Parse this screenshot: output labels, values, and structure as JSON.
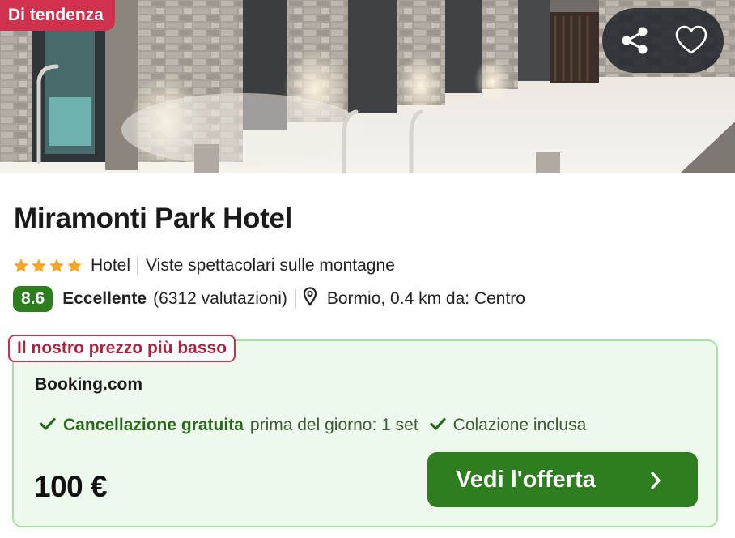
{
  "hero": {
    "image_description": "",
    "badge": "Di tendenza"
  },
  "actions": {
    "share_icon": "share-icon",
    "favorite_icon": "heart-outline-icon"
  },
  "hotel": {
    "name": "Miramonti Park Hotel",
    "stars": 4,
    "type": "Hotel",
    "tagline": "Viste spettacolari sulle montagne",
    "score": "8.6",
    "score_label": "Eccellente",
    "reviews": "(6312 valutazioni)",
    "location": "Bormio, 0.4 km da: Centro"
  },
  "offer": {
    "badge": "Il nostro prezzo più basso",
    "provider": "Booking.com",
    "feature1_strong": "Cancellazione gratuita",
    "feature1_rest": "prima del giorno: 1 set",
    "feature2": "Colazione inclusa",
    "price": "100 €",
    "cta": "Vedi l'offerta"
  },
  "colors": {
    "accent_green": "#2e7d1f",
    "badge_red": "#d0314d",
    "card_bg": "#ecf9ec",
    "star_orange": "#f5a623"
  }
}
